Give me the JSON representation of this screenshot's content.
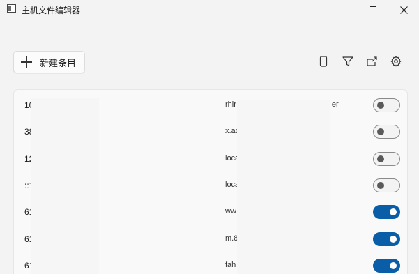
{
  "window": {
    "title": "主机文件编辑器",
    "controls": [
      "minimize",
      "maximize",
      "close"
    ]
  },
  "toolbar": {
    "new_label": "新建条目",
    "icons": [
      "device-icon",
      "filter-icon",
      "export-icon",
      "settings-icon"
    ]
  },
  "entries": [
    {
      "ip": "10",
      "host": "rhir",
      "host_suffix": "er",
      "enabled": false
    },
    {
      "ip": "38",
      "host": "x.ac",
      "host_suffix": "",
      "enabled": false
    },
    {
      "ip": "12",
      "host": "loca",
      "host_suffix": "",
      "enabled": false
    },
    {
      "ip": "::1",
      "host": "loca",
      "host_suffix": "",
      "enabled": false
    },
    {
      "ip": "61",
      "host": "ww",
      "host_suffix": "",
      "enabled": true
    },
    {
      "ip": "61",
      "host": "m.8",
      "host_suffix": "",
      "enabled": true
    },
    {
      "ip": "61",
      "host": "fah",
      "host_suffix": "",
      "enabled": true
    }
  ],
  "colors": {
    "accent": "#0a5ea8",
    "background": "#f3f3f3",
    "card": "#f9f9f9"
  }
}
